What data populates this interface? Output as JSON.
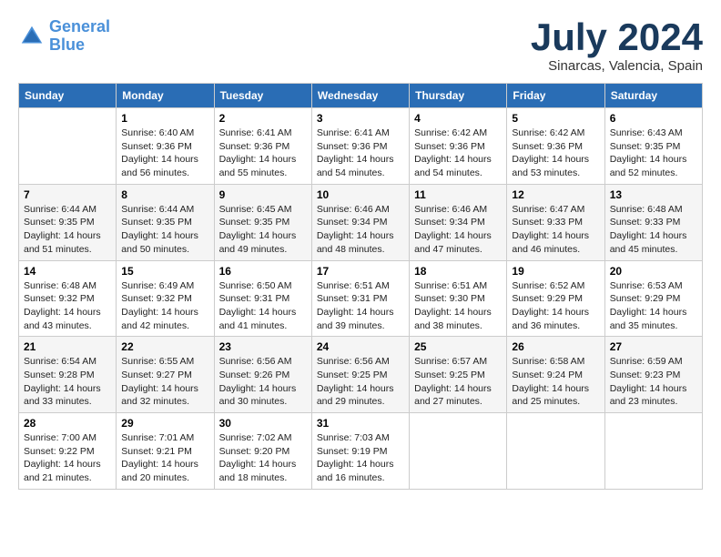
{
  "logo": {
    "line1": "General",
    "line2": "Blue"
  },
  "title": "July 2024",
  "subtitle": "Sinarcas, Valencia, Spain",
  "weekdays": [
    "Sunday",
    "Monday",
    "Tuesday",
    "Wednesday",
    "Thursday",
    "Friday",
    "Saturday"
  ],
  "weeks": [
    [
      {
        "day": "",
        "sunrise": "",
        "sunset": "",
        "daylight": ""
      },
      {
        "day": "1",
        "sunrise": "Sunrise: 6:40 AM",
        "sunset": "Sunset: 9:36 PM",
        "daylight": "Daylight: 14 hours and 56 minutes."
      },
      {
        "day": "2",
        "sunrise": "Sunrise: 6:41 AM",
        "sunset": "Sunset: 9:36 PM",
        "daylight": "Daylight: 14 hours and 55 minutes."
      },
      {
        "day": "3",
        "sunrise": "Sunrise: 6:41 AM",
        "sunset": "Sunset: 9:36 PM",
        "daylight": "Daylight: 14 hours and 54 minutes."
      },
      {
        "day": "4",
        "sunrise": "Sunrise: 6:42 AM",
        "sunset": "Sunset: 9:36 PM",
        "daylight": "Daylight: 14 hours and 54 minutes."
      },
      {
        "day": "5",
        "sunrise": "Sunrise: 6:42 AM",
        "sunset": "Sunset: 9:36 PM",
        "daylight": "Daylight: 14 hours and 53 minutes."
      },
      {
        "day": "6",
        "sunrise": "Sunrise: 6:43 AM",
        "sunset": "Sunset: 9:35 PM",
        "daylight": "Daylight: 14 hours and 52 minutes."
      }
    ],
    [
      {
        "day": "7",
        "sunrise": "Sunrise: 6:44 AM",
        "sunset": "Sunset: 9:35 PM",
        "daylight": "Daylight: 14 hours and 51 minutes."
      },
      {
        "day": "8",
        "sunrise": "Sunrise: 6:44 AM",
        "sunset": "Sunset: 9:35 PM",
        "daylight": "Daylight: 14 hours and 50 minutes."
      },
      {
        "day": "9",
        "sunrise": "Sunrise: 6:45 AM",
        "sunset": "Sunset: 9:35 PM",
        "daylight": "Daylight: 14 hours and 49 minutes."
      },
      {
        "day": "10",
        "sunrise": "Sunrise: 6:46 AM",
        "sunset": "Sunset: 9:34 PM",
        "daylight": "Daylight: 14 hours and 48 minutes."
      },
      {
        "day": "11",
        "sunrise": "Sunrise: 6:46 AM",
        "sunset": "Sunset: 9:34 PM",
        "daylight": "Daylight: 14 hours and 47 minutes."
      },
      {
        "day": "12",
        "sunrise": "Sunrise: 6:47 AM",
        "sunset": "Sunset: 9:33 PM",
        "daylight": "Daylight: 14 hours and 46 minutes."
      },
      {
        "day": "13",
        "sunrise": "Sunrise: 6:48 AM",
        "sunset": "Sunset: 9:33 PM",
        "daylight": "Daylight: 14 hours and 45 minutes."
      }
    ],
    [
      {
        "day": "14",
        "sunrise": "Sunrise: 6:48 AM",
        "sunset": "Sunset: 9:32 PM",
        "daylight": "Daylight: 14 hours and 43 minutes."
      },
      {
        "day": "15",
        "sunrise": "Sunrise: 6:49 AM",
        "sunset": "Sunset: 9:32 PM",
        "daylight": "Daylight: 14 hours and 42 minutes."
      },
      {
        "day": "16",
        "sunrise": "Sunrise: 6:50 AM",
        "sunset": "Sunset: 9:31 PM",
        "daylight": "Daylight: 14 hours and 41 minutes."
      },
      {
        "day": "17",
        "sunrise": "Sunrise: 6:51 AM",
        "sunset": "Sunset: 9:31 PM",
        "daylight": "Daylight: 14 hours and 39 minutes."
      },
      {
        "day": "18",
        "sunrise": "Sunrise: 6:51 AM",
        "sunset": "Sunset: 9:30 PM",
        "daylight": "Daylight: 14 hours and 38 minutes."
      },
      {
        "day": "19",
        "sunrise": "Sunrise: 6:52 AM",
        "sunset": "Sunset: 9:29 PM",
        "daylight": "Daylight: 14 hours and 36 minutes."
      },
      {
        "day": "20",
        "sunrise": "Sunrise: 6:53 AM",
        "sunset": "Sunset: 9:29 PM",
        "daylight": "Daylight: 14 hours and 35 minutes."
      }
    ],
    [
      {
        "day": "21",
        "sunrise": "Sunrise: 6:54 AM",
        "sunset": "Sunset: 9:28 PM",
        "daylight": "Daylight: 14 hours and 33 minutes."
      },
      {
        "day": "22",
        "sunrise": "Sunrise: 6:55 AM",
        "sunset": "Sunset: 9:27 PM",
        "daylight": "Daylight: 14 hours and 32 minutes."
      },
      {
        "day": "23",
        "sunrise": "Sunrise: 6:56 AM",
        "sunset": "Sunset: 9:26 PM",
        "daylight": "Daylight: 14 hours and 30 minutes."
      },
      {
        "day": "24",
        "sunrise": "Sunrise: 6:56 AM",
        "sunset": "Sunset: 9:25 PM",
        "daylight": "Daylight: 14 hours and 29 minutes."
      },
      {
        "day": "25",
        "sunrise": "Sunrise: 6:57 AM",
        "sunset": "Sunset: 9:25 PM",
        "daylight": "Daylight: 14 hours and 27 minutes."
      },
      {
        "day": "26",
        "sunrise": "Sunrise: 6:58 AM",
        "sunset": "Sunset: 9:24 PM",
        "daylight": "Daylight: 14 hours and 25 minutes."
      },
      {
        "day": "27",
        "sunrise": "Sunrise: 6:59 AM",
        "sunset": "Sunset: 9:23 PM",
        "daylight": "Daylight: 14 hours and 23 minutes."
      }
    ],
    [
      {
        "day": "28",
        "sunrise": "Sunrise: 7:00 AM",
        "sunset": "Sunset: 9:22 PM",
        "daylight": "Daylight: 14 hours and 21 minutes."
      },
      {
        "day": "29",
        "sunrise": "Sunrise: 7:01 AM",
        "sunset": "Sunset: 9:21 PM",
        "daylight": "Daylight: 14 hours and 20 minutes."
      },
      {
        "day": "30",
        "sunrise": "Sunrise: 7:02 AM",
        "sunset": "Sunset: 9:20 PM",
        "daylight": "Daylight: 14 hours and 18 minutes."
      },
      {
        "day": "31",
        "sunrise": "Sunrise: 7:03 AM",
        "sunset": "Sunset: 9:19 PM",
        "daylight": "Daylight: 14 hours and 16 minutes."
      },
      {
        "day": "",
        "sunrise": "",
        "sunset": "",
        "daylight": ""
      },
      {
        "day": "",
        "sunrise": "",
        "sunset": "",
        "daylight": ""
      },
      {
        "day": "",
        "sunrise": "",
        "sunset": "",
        "daylight": ""
      }
    ]
  ]
}
